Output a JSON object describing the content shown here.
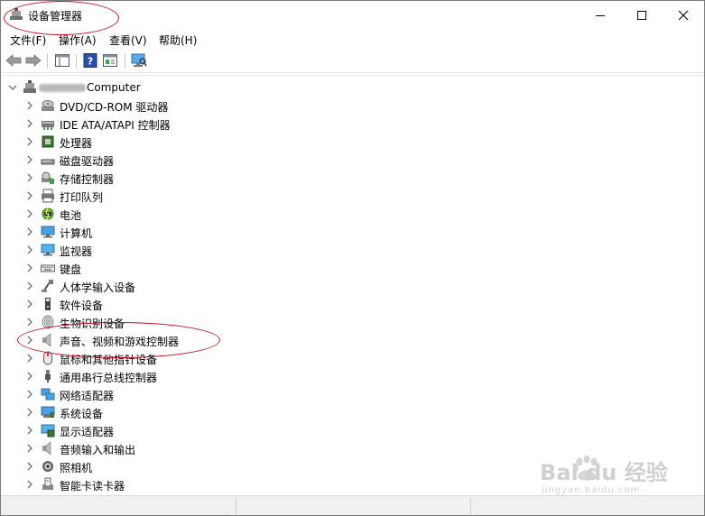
{
  "window": {
    "title": "设备管理器",
    "controls": {
      "minimize": "—",
      "maximize": "☐",
      "close": "✕"
    }
  },
  "menu": [
    {
      "label": "文件(F)"
    },
    {
      "label": "操作(A)"
    },
    {
      "label": "查看(V)"
    },
    {
      "label": "帮助(H)"
    }
  ],
  "tree": {
    "root": {
      "label": "Computer",
      "expanded": true
    },
    "items": [
      {
        "label": "DVD/CD-ROM 驱动器",
        "icon": "dvd-drive-icon"
      },
      {
        "label": "IDE ATA/ATAPI 控制器",
        "icon": "ide-controller-icon"
      },
      {
        "label": "处理器",
        "icon": "processor-icon"
      },
      {
        "label": "磁盘驱动器",
        "icon": "disk-drive-icon"
      },
      {
        "label": "存储控制器",
        "icon": "storage-controller-icon"
      },
      {
        "label": "打印队列",
        "icon": "printer-icon"
      },
      {
        "label": "电池",
        "icon": "battery-icon"
      },
      {
        "label": "计算机",
        "icon": "computer-icon"
      },
      {
        "label": "监视器",
        "icon": "monitor-icon"
      },
      {
        "label": "键盘",
        "icon": "keyboard-icon"
      },
      {
        "label": "人体学输入设备",
        "icon": "hid-icon"
      },
      {
        "label": "软件设备",
        "icon": "software-device-icon"
      },
      {
        "label": "生物识别设备",
        "icon": "fingerprint-icon"
      },
      {
        "label": "声音、视频和游戏控制器",
        "icon": "speaker-icon"
      },
      {
        "label": "鼠标和其他指针设备",
        "icon": "mouse-icon"
      },
      {
        "label": "通用串行总线控制器",
        "icon": "usb-icon"
      },
      {
        "label": "网络适配器",
        "icon": "network-adapter-icon"
      },
      {
        "label": "系统设备",
        "icon": "system-device-icon"
      },
      {
        "label": "显示适配器",
        "icon": "display-adapter-icon"
      },
      {
        "label": "音频输入和输出",
        "icon": "audio-io-icon"
      },
      {
        "label": "照相机",
        "icon": "camera-icon"
      },
      {
        "label": "智能卡读卡器",
        "icon": "smart-card-reader-icon"
      }
    ]
  },
  "colors": {
    "annotation": "#c8101e",
    "tree_chevron": "#6d6d6d",
    "window_border": "#7a7a7a"
  },
  "watermark": {
    "line1": "Bai du 经验",
    "line2": "jingyan.baidu.com"
  }
}
